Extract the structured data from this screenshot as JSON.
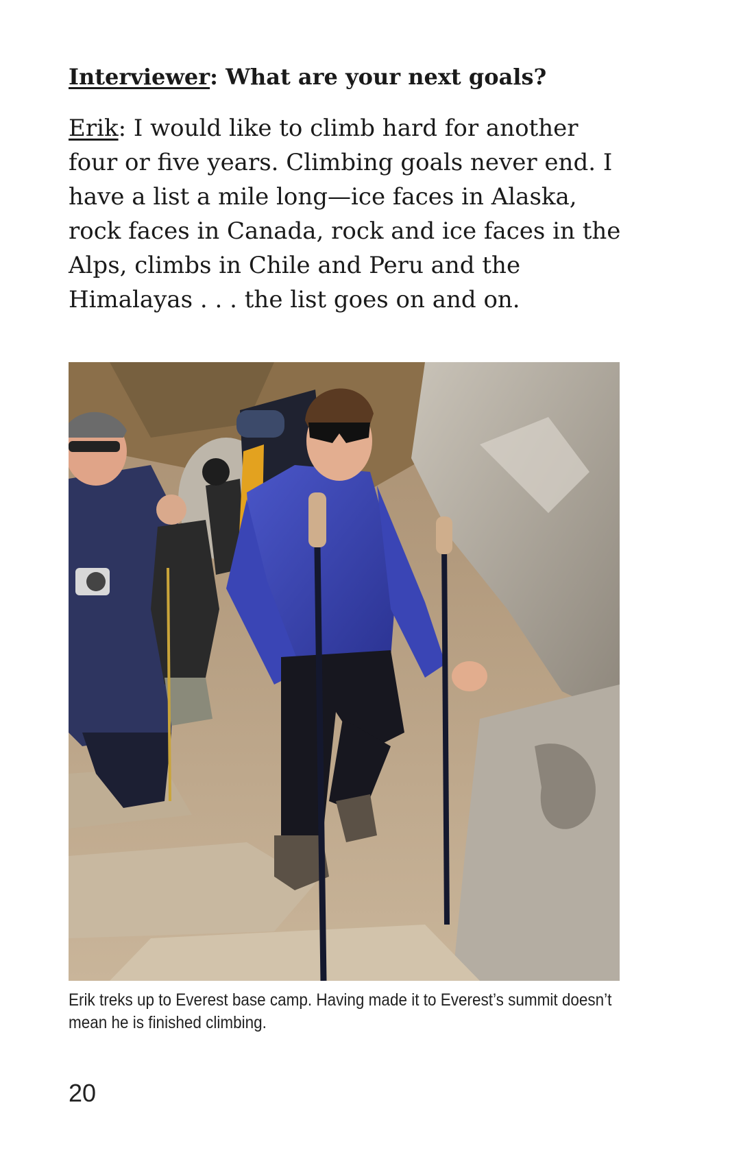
{
  "interview": {
    "question": {
      "speaker": "Interviewer",
      "text": ": What are your next goals?"
    },
    "answer": {
      "speaker": "Erik",
      "text": ": I would like to climb hard for another four or five years. Climbing goals never end. I have a list a mile long—ice faces in Alaska, rock faces in Canada, rock and ice faces in the Alps, climbs in Chile and Peru and the Himalayas . . . the list goes on and on."
    }
  },
  "photo": {
    "caption": "Erik treks up to Everest base camp. Having made it to Everest’s summit doesn’t mean he is finished climbing."
  },
  "page": {
    "number": "20"
  }
}
